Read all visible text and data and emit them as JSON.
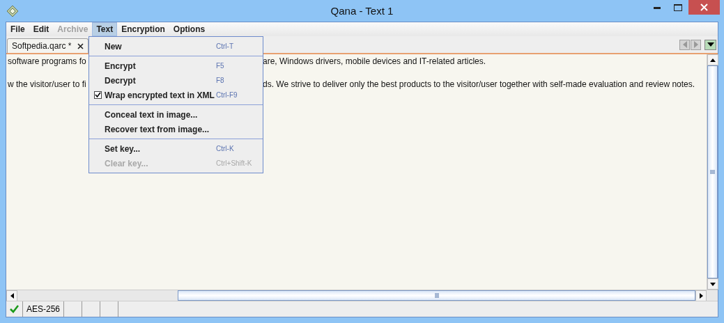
{
  "window": {
    "title": "Qana - Text 1"
  },
  "menu_bar": [
    {
      "label": "File",
      "disabled": false,
      "selected": false
    },
    {
      "label": "Edit",
      "disabled": false,
      "selected": false
    },
    {
      "label": "Archive",
      "disabled": true,
      "selected": false
    },
    {
      "label": "Text",
      "disabled": false,
      "selected": true
    },
    {
      "label": "Encryption",
      "disabled": false,
      "selected": false
    },
    {
      "label": "Options",
      "disabled": false,
      "selected": false
    }
  ],
  "tabs": [
    {
      "label": "Softpedia.qarc *",
      "selected": true
    }
  ],
  "editor_lines": [
    {
      "left": "software programs fo",
      "right": "are, Windows drivers, mobile devices and IT-related articles."
    },
    {
      "left": "w the visitor/user to fi",
      "right": "ds. We strive to deliver only the best products to the visitor/user together with self-made evaluation and review notes."
    }
  ],
  "text_menu": [
    [
      {
        "kind": "item",
        "label": "New",
        "shortcut": "Ctrl-T",
        "disabled": false
      }
    ],
    [
      {
        "kind": "item",
        "label": "Encrypt",
        "shortcut": "F5",
        "disabled": false
      },
      {
        "kind": "item",
        "label": "Decrypt",
        "shortcut": "F8",
        "disabled": false
      },
      {
        "kind": "check",
        "label": "Wrap encrypted text in XML",
        "shortcut": "Ctrl-F9",
        "disabled": false,
        "checked": true
      }
    ],
    [
      {
        "kind": "item",
        "label": "Conceal text in image...",
        "disabled": false
      },
      {
        "kind": "item",
        "label": "Recover text from image...",
        "disabled": false
      }
    ],
    [
      {
        "kind": "item",
        "label": "Set key...",
        "shortcut": "Ctrl-K",
        "disabled": false
      },
      {
        "kind": "item",
        "label": "Clear key...",
        "shortcut": "Ctrl+Shift-K",
        "disabled": true
      }
    ]
  ],
  "status_bar": {
    "ok": true,
    "algorithm": "AES-256"
  }
}
